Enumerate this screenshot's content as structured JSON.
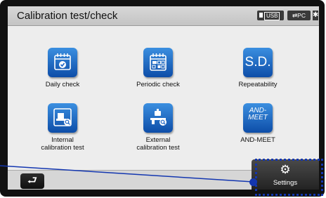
{
  "title": "Calibration test/check",
  "status": {
    "usb": "USB",
    "pc": "PC",
    "bluetooth_icon": "bluetooth-icon"
  },
  "items": [
    {
      "label": "Daily check",
      "icon": "calendar-check-icon"
    },
    {
      "label": "Periodic check",
      "icon": "calendar-grid-icon"
    },
    {
      "label": "Repeatability",
      "icon_text": "S.D."
    },
    {
      "label": "Internal\ncalibration test",
      "icon": "internal-weight-icon"
    },
    {
      "label": "External\ncalibration test",
      "icon": "external-weight-icon"
    },
    {
      "label": "AND-MEET",
      "icon_text": "AND-\nMEET"
    }
  ],
  "footer": {
    "back_icon": "return-arrow-icon",
    "settings_label": "Settings",
    "settings_icon": "gear-icon"
  },
  "colors": {
    "icon_blue": "#1a63c6",
    "callout": "#1336b0"
  }
}
